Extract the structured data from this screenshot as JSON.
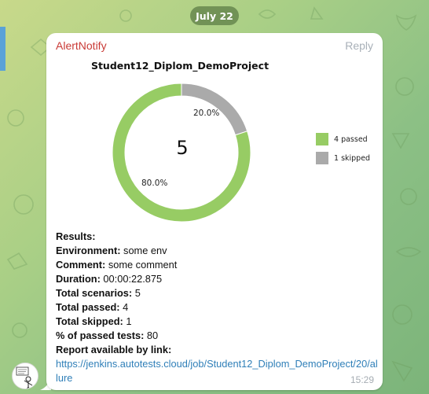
{
  "chat": {
    "date": "July 22"
  },
  "message": {
    "sender": "AlertNotify",
    "reply_label": "Reply",
    "time": "15:29",
    "lines": [
      {
        "label": "Results:",
        "value": ""
      },
      {
        "label": "Environment:",
        "value": " some env"
      },
      {
        "label": "Comment:",
        "value": " some comment"
      },
      {
        "label": "Duration:",
        "value": " 00:00:22.875"
      },
      {
        "label": "Total scenarios:",
        "value": " 5"
      },
      {
        "label": "Total passed:",
        "value": " 4"
      },
      {
        "label": "Total skipped:",
        "value": " 1"
      },
      {
        "label": "% of passed tests:",
        "value": " 80"
      },
      {
        "label": "Report available by link:",
        "value": ""
      }
    ],
    "link": "https://jenkins.autotests.cloud/job/Student12_Diplom_DemoProject/20/allure"
  },
  "chart_data": {
    "type": "pie",
    "title": "Student12_Diplom_DemoProject",
    "center_label": "5",
    "slices": [
      {
        "label": "4 passed",
        "value": 4,
        "percent_label": "80.0%",
        "color": "#97cc64"
      },
      {
        "label": "1 skipped",
        "value": 1,
        "percent_label": "20.0%",
        "color": "#aaaaaa"
      }
    ],
    "legend_position": "right"
  }
}
